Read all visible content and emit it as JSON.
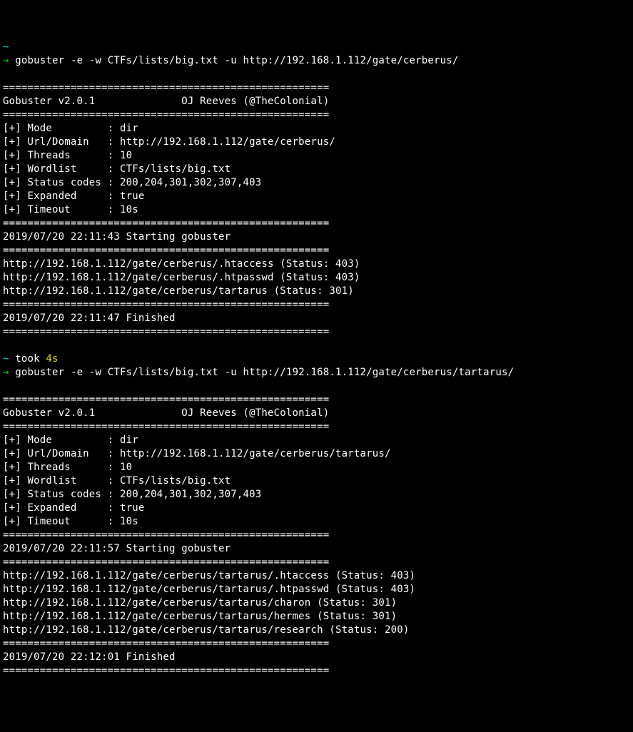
{
  "prompt1": {
    "tilde": "~",
    "arrow": "→",
    "cmd": "gobuster -e -w CTFs/lists/big.txt -u http://192.168.1.112/gate/cerberus/"
  },
  "run1": {
    "sep_long": "=====================================================",
    "header": "Gobuster v2.0.1              OJ Reeves (@TheColonial)",
    "settings": [
      "[+] Mode         : dir",
      "[+] Url/Domain   : http://192.168.1.112/gate/cerberus/",
      "[+] Threads      : 10",
      "[+] Wordlist     : CTFs/lists/big.txt",
      "[+] Status codes : 200,204,301,302,307,403",
      "[+] Expanded     : true",
      "[+] Timeout      : 10s"
    ],
    "start": "2019/07/20 22:11:43 Starting gobuster",
    "results": [
      "http://192.168.1.112/gate/cerberus/.htaccess (Status: 403)",
      "http://192.168.1.112/gate/cerberus/.htpasswd (Status: 403)",
      "http://192.168.1.112/gate/cerberus/tartarus (Status: 301)"
    ],
    "finish": "2019/07/20 22:11:47 Finished"
  },
  "between": {
    "tilde": "~",
    "took": " took ",
    "duration": "4s"
  },
  "prompt2": {
    "arrow": "→",
    "cmd": "gobuster -e -w CTFs/lists/big.txt -u http://192.168.1.112/gate/cerberus/tartarus/"
  },
  "run2": {
    "sep_long": "=====================================================",
    "header": "Gobuster v2.0.1              OJ Reeves (@TheColonial)",
    "settings": [
      "[+] Mode         : dir",
      "[+] Url/Domain   : http://192.168.1.112/gate/cerberus/tartarus/",
      "[+] Threads      : 10",
      "[+] Wordlist     : CTFs/lists/big.txt",
      "[+] Status codes : 200,204,301,302,307,403",
      "[+] Expanded     : true",
      "[+] Timeout      : 10s"
    ],
    "start": "2019/07/20 22:11:57 Starting gobuster",
    "results": [
      "http://192.168.1.112/gate/cerberus/tartarus/.htaccess (Status: 403)",
      "http://192.168.1.112/gate/cerberus/tartarus/.htpasswd (Status: 403)",
      "http://192.168.1.112/gate/cerberus/tartarus/charon (Status: 301)",
      "http://192.168.1.112/gate/cerberus/tartarus/hermes (Status: 301)",
      "http://192.168.1.112/gate/cerberus/tartarus/research (Status: 200)"
    ],
    "finish": "2019/07/20 22:12:01 Finished"
  }
}
